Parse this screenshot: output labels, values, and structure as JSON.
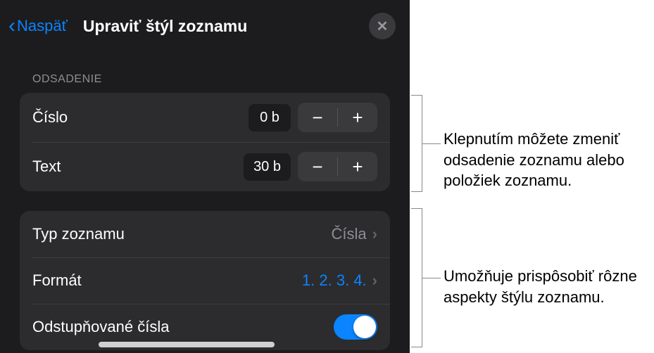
{
  "header": {
    "back_label": "Naspäť",
    "title": "Upraviť štýl zoznamu"
  },
  "section": {
    "odsadenie_header": "ODSADENIE"
  },
  "indent": {
    "cislo": {
      "label": "Číslo",
      "value": "0 b"
    },
    "text": {
      "label": "Text",
      "value": "30 b"
    }
  },
  "list_type": {
    "typ_label": "Typ zoznamu",
    "typ_value": "Čísla",
    "format_label": "Formát",
    "format_value": "1. 2. 3. 4.",
    "tiered_label": "Odstupňované čísla"
  },
  "callouts": {
    "c1": "Klepnutím môžete zmeniť odsadenie zoznamu alebo položiek zoznamu.",
    "c2": "Umožňuje prispôsobiť rôzne aspekty štýlu zoznamu."
  }
}
